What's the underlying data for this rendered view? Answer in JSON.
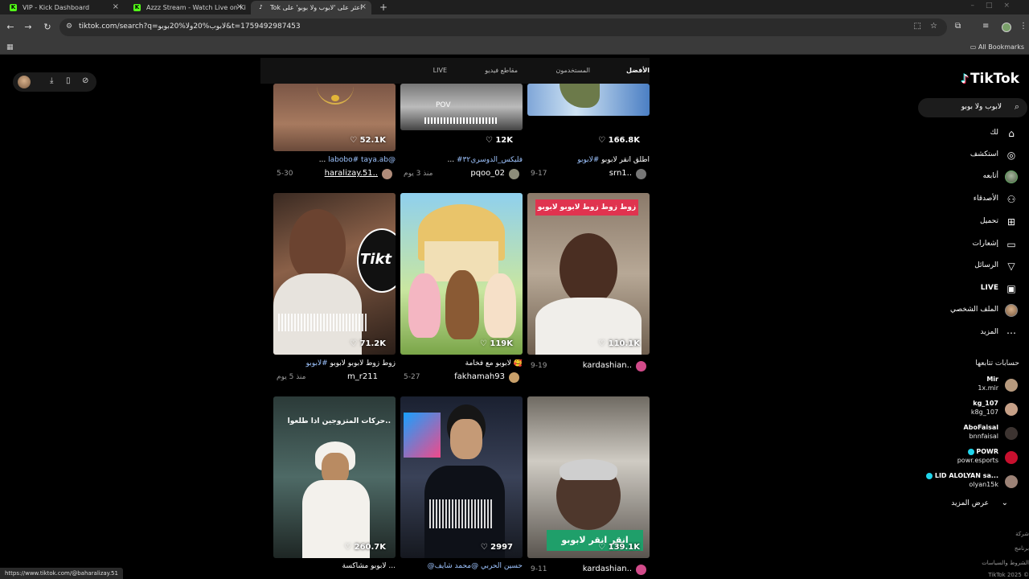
{
  "browser": {
    "tabs": [
      {
        "title": "VIP - Kick Dashboard",
        "icon": "K",
        "icon_color": "#53fc18",
        "active": false
      },
      {
        "title": "Azzz Stream - Watch Live on Ki",
        "icon": "K",
        "icon_color": "#53fc18",
        "active": false
      },
      {
        "title": "Tok اعثر على 'لابوب ولا بوبو' على",
        "icon": "♪",
        "icon_color": "#ffffff",
        "active": true
      }
    ],
    "new_tab": "+",
    "url": "tiktok.com/search?q=لابوب%20ولا%20بوبو&t=1759492987453",
    "all_bookmarks": "All Bookmarks",
    "status_url": "https://www.tiktok.com/@baharalizay.51"
  },
  "search_tabs": [
    {
      "label": "الأفضل",
      "active": true
    },
    {
      "label": "المستخدمون",
      "active": false
    },
    {
      "label": "مقاطع فيديو",
      "active": false
    },
    {
      "label": "LIVE",
      "active": false
    }
  ],
  "videos": [
    {
      "views": "52.1K",
      "caption_hl": "labobo# taya.ab@",
      "caption": "...",
      "user": "haralizay.51..",
      "date": "5-30"
    },
    {
      "views": "12K",
      "caption_hl": "#فليكس_الدوسري٣٢",
      "caption": "...",
      "user": "pqoo_02",
      "date": "منذ 3 يوم"
    },
    {
      "views": "166.8K",
      "caption_hl": "#لابوبو",
      "caption": "اطلق انقر لابوبو",
      "user": "srn1..",
      "date": "9-17"
    },
    {
      "views": "71.2K",
      "caption_hl": "#لابوبو",
      "caption": "زوط زوط لابوبو لابوبو",
      "user": "m_r211",
      "date": "منذ 5 يوم"
    },
    {
      "views": "119K",
      "caption_hl": "",
      "caption": "لابوبو مع فخامة 🥰",
      "user": "fakhamah93",
      "date": "5-27"
    },
    {
      "views": "110.1K",
      "caption_hl": "",
      "caption": "",
      "user": "kardashian..",
      "date": "9-19"
    },
    {
      "views": "260.7K",
      "caption_hl": "",
      "caption": "لابوبو مشاكسة ...",
      "user": "",
      "date": ""
    },
    {
      "views": "2997",
      "caption_hl": "@حسين الحربي @محمد شايف",
      "caption": "",
      "user": "",
      "date": ""
    },
    {
      "views": "139.1K",
      "caption_hl": "",
      "caption": "",
      "user": "kardashian..",
      "date": "9-11"
    }
  ],
  "overlay_texts": {
    "v6_banner": "زوط زوط زوط لابوبو لابوبو",
    "v7_top": "حركات المتزوجين اذا طلعوا..",
    "v9_bottom": "انقر انقر لابوبو",
    "v2_pov": "POV"
  },
  "sidebar": {
    "logo": "TikTok",
    "search_query": "لابوب ولا بوبو",
    "nav": [
      {
        "label": "لك",
        "icon": "⌂"
      },
      {
        "label": "استكشف",
        "icon": "◎"
      },
      {
        "label": "أتابعه",
        "icon": "avatar"
      },
      {
        "label": "الأصدقاء",
        "icon": "👥"
      },
      {
        "label": "تحميل",
        "icon": "⊞"
      },
      {
        "label": "إشعارات",
        "icon": "▭"
      },
      {
        "label": "الرسائل",
        "icon": "▽"
      },
      {
        "label": "LIVE",
        "icon": "▣"
      },
      {
        "label": "الملف الشخصي",
        "icon": "avatar"
      },
      {
        "label": "المزيد",
        "icon": "⋯"
      }
    ],
    "following_header": "حسابات تتابعها",
    "following": [
      {
        "name": "Mir",
        "handle": "1x.mir"
      },
      {
        "name": "kg_107",
        "handle": "k8g_107"
      },
      {
        "name": "AboFaisal",
        "handle": "bnnfaisal"
      },
      {
        "name": "POWR",
        "handle": "powr.esports"
      },
      {
        "name": "LID ALOLYAN sa...",
        "handle": "olyan15k"
      }
    ],
    "see_more": "عرض المزيد",
    "footer": [
      "شركة",
      "برنامج",
      "الشروط والسياسات",
      "TikTok 2025 ©"
    ]
  },
  "colors": {
    "accent_red": "#fe2c55",
    "accent_cyan": "#25f4ee",
    "link_blue": "#9ec4ff"
  }
}
